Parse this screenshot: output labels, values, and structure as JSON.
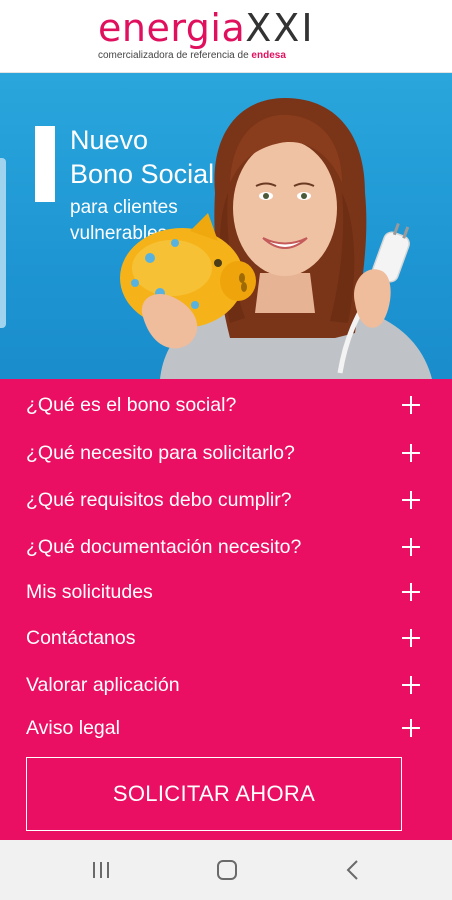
{
  "header": {
    "logo_main": "energia",
    "logo_xxi": "XXI",
    "logo_sub_text": "comercializadora de referencia de ",
    "logo_sub_brand": "endesa"
  },
  "banner": {
    "title_line1": "Nuevo",
    "title_line2": "Bono Social",
    "subtitle_line1": "para clientes",
    "subtitle_line2": "vulnerables"
  },
  "menu": {
    "items": [
      {
        "label": "¿Qué es el bono social?"
      },
      {
        "label": "¿Qué necesito para solicitarlo?"
      },
      {
        "label": "¿Qué requisitos debo cumplir?"
      },
      {
        "label": "¿Qué documentación necesito?"
      },
      {
        "label": "Mis solicitudes"
      },
      {
        "label": "Contáctanos"
      },
      {
        "label": "Valorar aplicación"
      },
      {
        "label": "Aviso legal"
      }
    ],
    "cta_label": "SOLICITAR AHORA"
  },
  "colors": {
    "brand_pink": "#ea0f63",
    "banner_blue": "#1e96d3",
    "logo_gray": "#333333"
  },
  "navbar": {
    "icons": [
      "recent-apps-icon",
      "home-icon",
      "back-icon"
    ]
  }
}
